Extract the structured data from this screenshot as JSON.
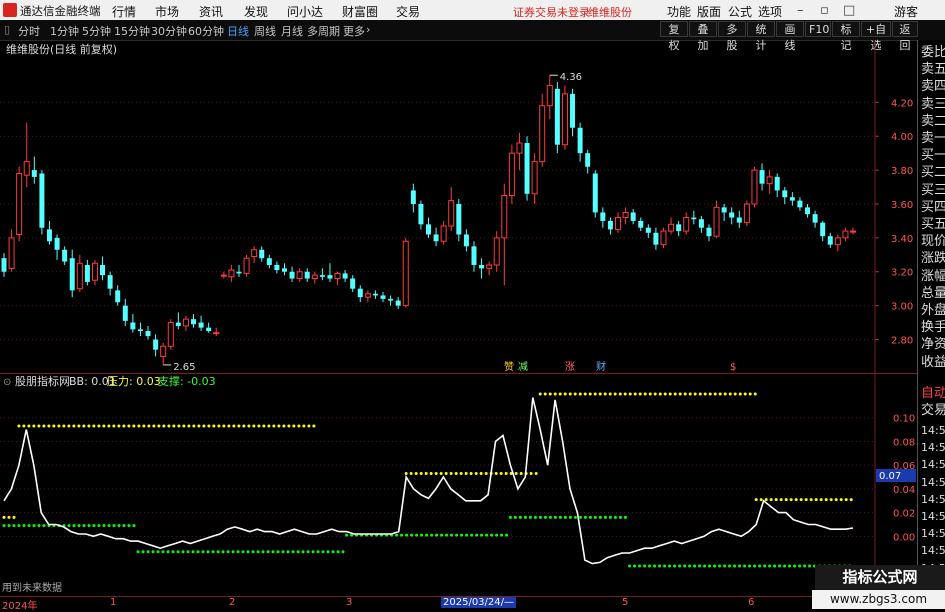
{
  "app": {
    "name": "通达信金融终端",
    "menu": [
      "行情",
      "市场",
      "资讯",
      "发现",
      "问小达",
      "财富圈",
      "交易"
    ],
    "warning": "证券交易未登录",
    "stock_name": "维维股份",
    "right_menu": [
      "功能",
      "版面",
      "公式",
      "选项"
    ],
    "guest": "游客"
  },
  "period_bar": {
    "periods": [
      "分时",
      "1分钟",
      "5分钟",
      "15分钟",
      "30分钟",
      "60分钟",
      "日线",
      "周线",
      "月线",
      "多周期",
      "更多"
    ],
    "active": "日线",
    "buttons": [
      "复权",
      "叠加",
      "多股",
      "统计",
      "画线",
      "F10",
      "标记",
      "+自选",
      "返回"
    ]
  },
  "main_chart": {
    "title": "维维股份(日线 前复权)",
    "high_label": "4.36",
    "low_label": "2.65",
    "event_marks": [
      "赞",
      "减",
      "涨",
      "财",
      "$"
    ]
  },
  "sub_chart": {
    "name": "股朋指标网",
    "bb_label": "BB: 0.01",
    "pressure_label": "压力: 0.03",
    "support_label": "支撑: -0.03",
    "current_value": "0.07",
    "note": "用到未来数据"
  },
  "right_panel": {
    "items": [
      "委比",
      "卖五",
      "卖四",
      "卖三",
      "卖二",
      "卖一",
      "买一",
      "买二",
      "买三",
      "买四",
      "买五",
      "现价",
      "涨跌",
      "涨幅",
      "总量",
      "外盘",
      "换手",
      "净资",
      "收益"
    ],
    "trade_items": [
      "自动",
      "交易"
    ],
    "times": [
      "14:56",
      "14:56",
      "14:56",
      "14:56",
      "14:56",
      "14:56",
      "14:56",
      "14:56",
      "14:56",
      "14:56"
    ]
  },
  "time_axis": [
    "2024年",
    "1",
    "2",
    "3",
    "2025/03/24/—",
    "5",
    "6"
  ],
  "watermark": {
    "title": "指标公式网",
    "url": "www.zbgs3.com"
  },
  "colors": {
    "up": "#ff3b3b",
    "down": "#54ffff",
    "line": "#ffffff",
    "pressure": "#ffff00",
    "support": "#00ff00",
    "grid": "#5a1414"
  },
  "chart_data": [
    {
      "type": "candlestick",
      "title": "维维股份(日线 前复权)",
      "y_ticks": [
        4.2,
        4.0,
        3.8,
        3.6,
        3.4,
        3.2,
        3.0,
        2.8
      ],
      "ylim": [
        2.62,
        4.45
      ],
      "x_labels": [
        "2024年",
        "1",
        "2",
        "3",
        "2025/03/24/—",
        "5",
        "6"
      ],
      "max": 4.36,
      "min": 2.65,
      "ohlc": [
        [
          3.28,
          3.31,
          3.17,
          3.2
        ],
        [
          3.22,
          3.45,
          3.2,
          3.4
        ],
        [
          3.42,
          3.82,
          3.38,
          3.78
        ],
        [
          3.77,
          4.08,
          3.7,
          3.85
        ],
        [
          3.8,
          3.88,
          3.72,
          3.76
        ],
        [
          3.78,
          3.8,
          3.42,
          3.46
        ],
        [
          3.45,
          3.5,
          3.36,
          3.38
        ],
        [
          3.4,
          3.42,
          3.27,
          3.33
        ],
        [
          3.33,
          3.35,
          3.24,
          3.26
        ],
        [
          3.28,
          3.33,
          3.05,
          3.09
        ],
        [
          3.1,
          3.3,
          3.08,
          3.25
        ],
        [
          3.24,
          3.27,
          3.12,
          3.14
        ],
        [
          3.15,
          3.27,
          3.12,
          3.25
        ],
        [
          3.24,
          3.29,
          3.15,
          3.18
        ],
        [
          3.18,
          3.2,
          3.06,
          3.1
        ],
        [
          3.09,
          3.12,
          3.0,
          3.02
        ],
        [
          3.0,
          3.04,
          2.88,
          2.91
        ],
        [
          2.9,
          2.95,
          2.84,
          2.86
        ],
        [
          2.86,
          2.9,
          2.82,
          2.85
        ],
        [
          2.85,
          2.88,
          2.8,
          2.82
        ],
        [
          2.8,
          2.83,
          2.7,
          2.74
        ],
        [
          2.7,
          2.78,
          2.65,
          2.76
        ],
        [
          2.76,
          2.92,
          2.74,
          2.9
        ],
        [
          2.9,
          2.96,
          2.86,
          2.88
        ],
        [
          2.88,
          2.94,
          2.85,
          2.92
        ],
        [
          2.92,
          2.95,
          2.87,
          2.89
        ],
        [
          2.9,
          2.94,
          2.85,
          2.87
        ],
        [
          2.87,
          2.9,
          2.84,
          2.85
        ],
        [
          2.84,
          2.87,
          2.82,
          2.84
        ],
        [
          3.18,
          3.2,
          3.16,
          3.18
        ],
        [
          3.17,
          3.24,
          3.14,
          3.21
        ],
        [
          3.2,
          3.24,
          3.17,
          3.19
        ],
        [
          3.19,
          3.3,
          3.17,
          3.28
        ],
        [
          3.29,
          3.35,
          3.25,
          3.33
        ],
        [
          3.33,
          3.35,
          3.26,
          3.28
        ],
        [
          3.28,
          3.3,
          3.22,
          3.24
        ],
        [
          3.24,
          3.26,
          3.19,
          3.21
        ],
        [
          3.22,
          3.25,
          3.18,
          3.2
        ],
        [
          3.2,
          3.23,
          3.14,
          3.16
        ],
        [
          3.16,
          3.22,
          3.14,
          3.2
        ],
        [
          3.2,
          3.22,
          3.14,
          3.16
        ],
        [
          3.16,
          3.2,
          3.13,
          3.18
        ],
        [
          3.18,
          3.22,
          3.15,
          3.17
        ],
        [
          3.18,
          3.25,
          3.14,
          3.16
        ],
        [
          3.16,
          3.2,
          3.12,
          3.19
        ],
        [
          3.19,
          3.21,
          3.14,
          3.16
        ],
        [
          3.16,
          3.18,
          3.08,
          3.1
        ],
        [
          3.1,
          3.12,
          3.02,
          3.05
        ],
        [
          3.05,
          3.09,
          3.02,
          3.07
        ],
        [
          3.07,
          3.09,
          3.04,
          3.06
        ],
        [
          3.06,
          3.08,
          3.02,
          3.04
        ],
        [
          3.04,
          3.06,
          3.0,
          3.03
        ],
        [
          3.03,
          3.05,
          2.98,
          3.0
        ],
        [
          3.0,
          3.4,
          2.99,
          3.38
        ],
        [
          3.68,
          3.72,
          3.55,
          3.6
        ],
        [
          3.6,
          3.62,
          3.45,
          3.48
        ],
        [
          3.48,
          3.52,
          3.4,
          3.42
        ],
        [
          3.42,
          3.46,
          3.35,
          3.38
        ],
        [
          3.38,
          3.5,
          3.36,
          3.47
        ],
        [
          3.47,
          3.7,
          3.44,
          3.62
        ],
        [
          3.6,
          3.63,
          3.38,
          3.42
        ],
        [
          3.42,
          3.45,
          3.32,
          3.35
        ],
        [
          3.35,
          3.38,
          3.2,
          3.24
        ],
        [
          3.24,
          3.28,
          3.16,
          3.22
        ],
        [
          3.22,
          3.26,
          3.18,
          3.24
        ],
        [
          3.24,
          3.44,
          3.2,
          3.4
        ],
        [
          3.4,
          3.72,
          3.12,
          3.65
        ],
        [
          3.65,
          3.95,
          3.6,
          3.9
        ],
        [
          3.9,
          4.02,
          3.8,
          3.96
        ],
        [
          3.96,
          4.0,
          3.62,
          3.66
        ],
        [
          3.66,
          3.9,
          3.6,
          3.85
        ],
        [
          3.85,
          4.25,
          3.82,
          4.18
        ],
        [
          4.18,
          4.36,
          4.1,
          4.3
        ],
        [
          4.28,
          4.32,
          3.9,
          3.95
        ],
        [
          3.95,
          4.3,
          3.92,
          4.25
        ],
        [
          4.25,
          4.28,
          4.0,
          4.05
        ],
        [
          4.05,
          4.08,
          3.85,
          3.9
        ],
        [
          3.9,
          3.92,
          3.78,
          3.82
        ],
        [
          3.78,
          3.8,
          3.52,
          3.55
        ],
        [
          3.55,
          3.58,
          3.46,
          3.5
        ],
        [
          3.5,
          3.52,
          3.42,
          3.45
        ],
        [
          3.45,
          3.55,
          3.43,
          3.52
        ],
        [
          3.52,
          3.58,
          3.48,
          3.55
        ],
        [
          3.55,
          3.57,
          3.48,
          3.5
        ],
        [
          3.5,
          3.52,
          3.44,
          3.46
        ],
        [
          3.46,
          3.48,
          3.4,
          3.43
        ],
        [
          3.43,
          3.46,
          3.33,
          3.36
        ],
        [
          3.36,
          3.46,
          3.34,
          3.44
        ],
        [
          3.44,
          3.52,
          3.42,
          3.48
        ],
        [
          3.48,
          3.5,
          3.41,
          3.44
        ],
        [
          3.44,
          3.55,
          3.42,
          3.52
        ],
        [
          3.52,
          3.56,
          3.48,
          3.51
        ],
        [
          3.51,
          3.53,
          3.43,
          3.46
        ],
        [
          3.46,
          3.48,
          3.38,
          3.41
        ],
        [
          3.41,
          3.62,
          3.4,
          3.58
        ],
        [
          3.58,
          3.6,
          3.5,
          3.55
        ],
        [
          3.55,
          3.58,
          3.48,
          3.52
        ],
        [
          3.52,
          3.56,
          3.46,
          3.49
        ],
        [
          3.49,
          3.62,
          3.47,
          3.6
        ],
        [
          3.6,
          3.82,
          3.58,
          3.8
        ],
        [
          3.8,
          3.84,
          3.68,
          3.72
        ],
        [
          3.72,
          3.8,
          3.66,
          3.76
        ],
        [
          3.76,
          3.78,
          3.64,
          3.68
        ],
        [
          3.68,
          3.7,
          3.6,
          3.64
        ],
        [
          3.64,
          3.67,
          3.59,
          3.62
        ],
        [
          3.62,
          3.64,
          3.56,
          3.58
        ],
        [
          3.58,
          3.6,
          3.52,
          3.54
        ],
        [
          3.54,
          3.56,
          3.46,
          3.49
        ],
        [
          3.49,
          3.5,
          3.38,
          3.41
        ],
        [
          3.41,
          3.43,
          3.34,
          3.36
        ],
        [
          3.36,
          3.42,
          3.32,
          3.4
        ],
        [
          3.4,
          3.46,
          3.38,
          3.44
        ],
        [
          3.44,
          3.46,
          3.42,
          3.44
        ]
      ]
    },
    {
      "type": "line",
      "title": "股朋指标网",
      "y_ticks": [
        0.1,
        0.08,
        0.06,
        0.04,
        0.02,
        0.0
      ],
      "ylim": [
        -0.025,
        0.12
      ],
      "series": [
        {
          "name": "BB",
          "values": [
            0.03,
            0.04,
            0.06,
            0.09,
            0.06,
            0.02,
            0.01,
            0.01,
            0.008,
            0.004,
            0.002,
            0.002,
            0.0,
            0.002,
            0.0,
            -0.002,
            -0.002,
            -0.004,
            -0.004,
            -0.006,
            -0.008,
            -0.01,
            -0.008,
            -0.006,
            -0.004,
            -0.006,
            -0.004,
            -0.002,
            0.0,
            0.002,
            0.006,
            0.008,
            0.006,
            0.004,
            0.006,
            0.004,
            0.004,
            0.002,
            0.004,
            0.006,
            0.004,
            0.002,
            0.002,
            0.004,
            0.006,
            0.004,
            0.004,
            0.002,
            0.002,
            0.002,
            0.002,
            0.002,
            0.002,
            0.004,
            0.05,
            0.04,
            0.035,
            0.032,
            0.04,
            0.05,
            0.04,
            0.035,
            0.03,
            0.03,
            0.03,
            0.035,
            0.08,
            0.085,
            0.06,
            0.04,
            0.05,
            0.117,
            0.09,
            0.06,
            0.115,
            0.08,
            0.04,
            0.02,
            -0.02,
            -0.023,
            -0.022,
            -0.018,
            -0.016,
            -0.014,
            -0.014,
            -0.012,
            -0.01,
            -0.01,
            -0.008,
            -0.006,
            -0.004,
            -0.006,
            -0.004,
            -0.002,
            0.0,
            0.004,
            0.006,
            0.004,
            0.002,
            0.0,
            0.004,
            0.01,
            0.03,
            0.025,
            0.02,
            0.02,
            0.014,
            0.012,
            0.01,
            0.01,
            0.008,
            0.006,
            0.006,
            0.006,
            0.007
          ]
        },
        {
          "name": "压力",
          "segments": [
            [
              0,
              0.016
            ],
            [
              2,
              0.093
            ],
            [
              54,
              0.053
            ],
            [
              72,
              0.12
            ],
            [
              101,
              0.031
            ]
          ]
        },
        {
          "name": "支撑",
          "segments": [
            [
              0,
              0.009
            ],
            [
              18,
              -0.013
            ],
            [
              46,
              0.001
            ],
            [
              68,
              0.016
            ],
            [
              84,
              -0.025
            ]
          ]
        }
      ]
    }
  ]
}
